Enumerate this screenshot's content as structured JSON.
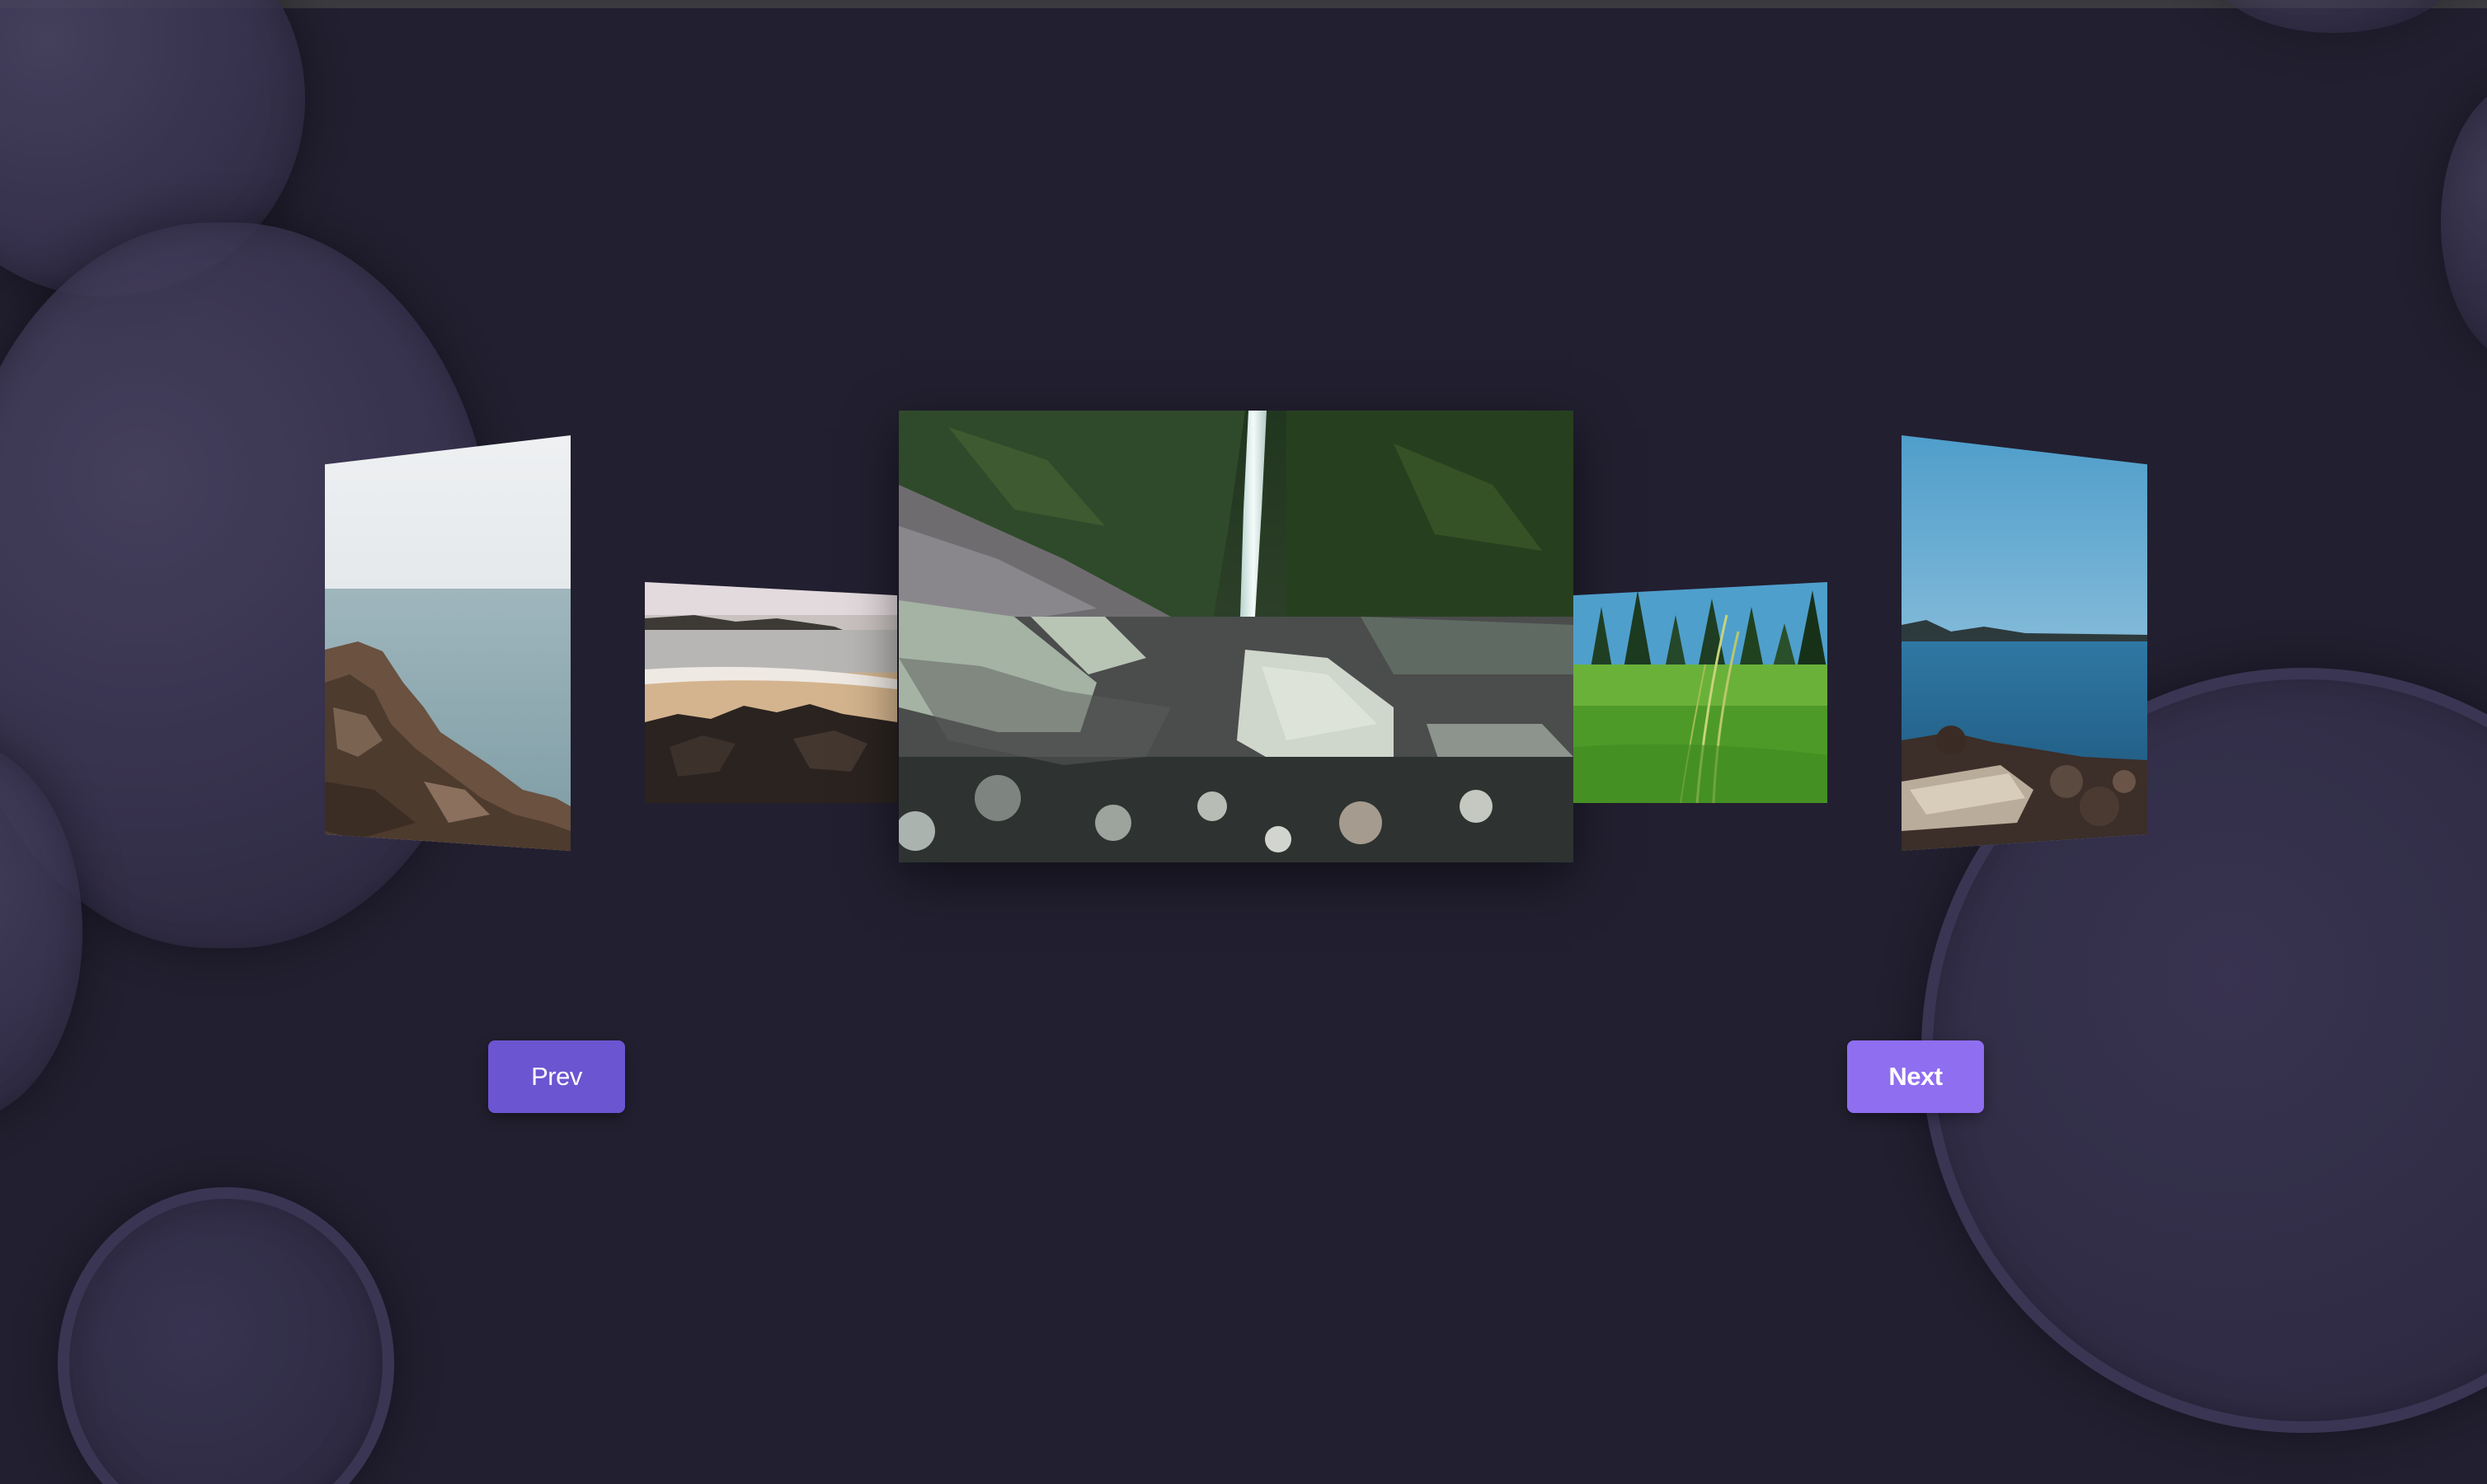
{
  "controls": {
    "prev_label": "Prev",
    "next_label": "Next"
  },
  "carousel": {
    "slides": [
      {
        "position": "far-left",
        "subject": "rocky-coast-sea"
      },
      {
        "position": "near-left",
        "subject": "beach-rocks-island"
      },
      {
        "position": "center",
        "subject": "waterfall-rocky-canyon"
      },
      {
        "position": "near-right",
        "subject": "grass-meadow-pines"
      },
      {
        "position": "far-right",
        "subject": "lake-shore-logs"
      }
    ]
  },
  "colors": {
    "background": "#221f30",
    "prev_button": "#6c55d0",
    "next_button": "#8f6ef0",
    "bubble": "#3a3552"
  }
}
